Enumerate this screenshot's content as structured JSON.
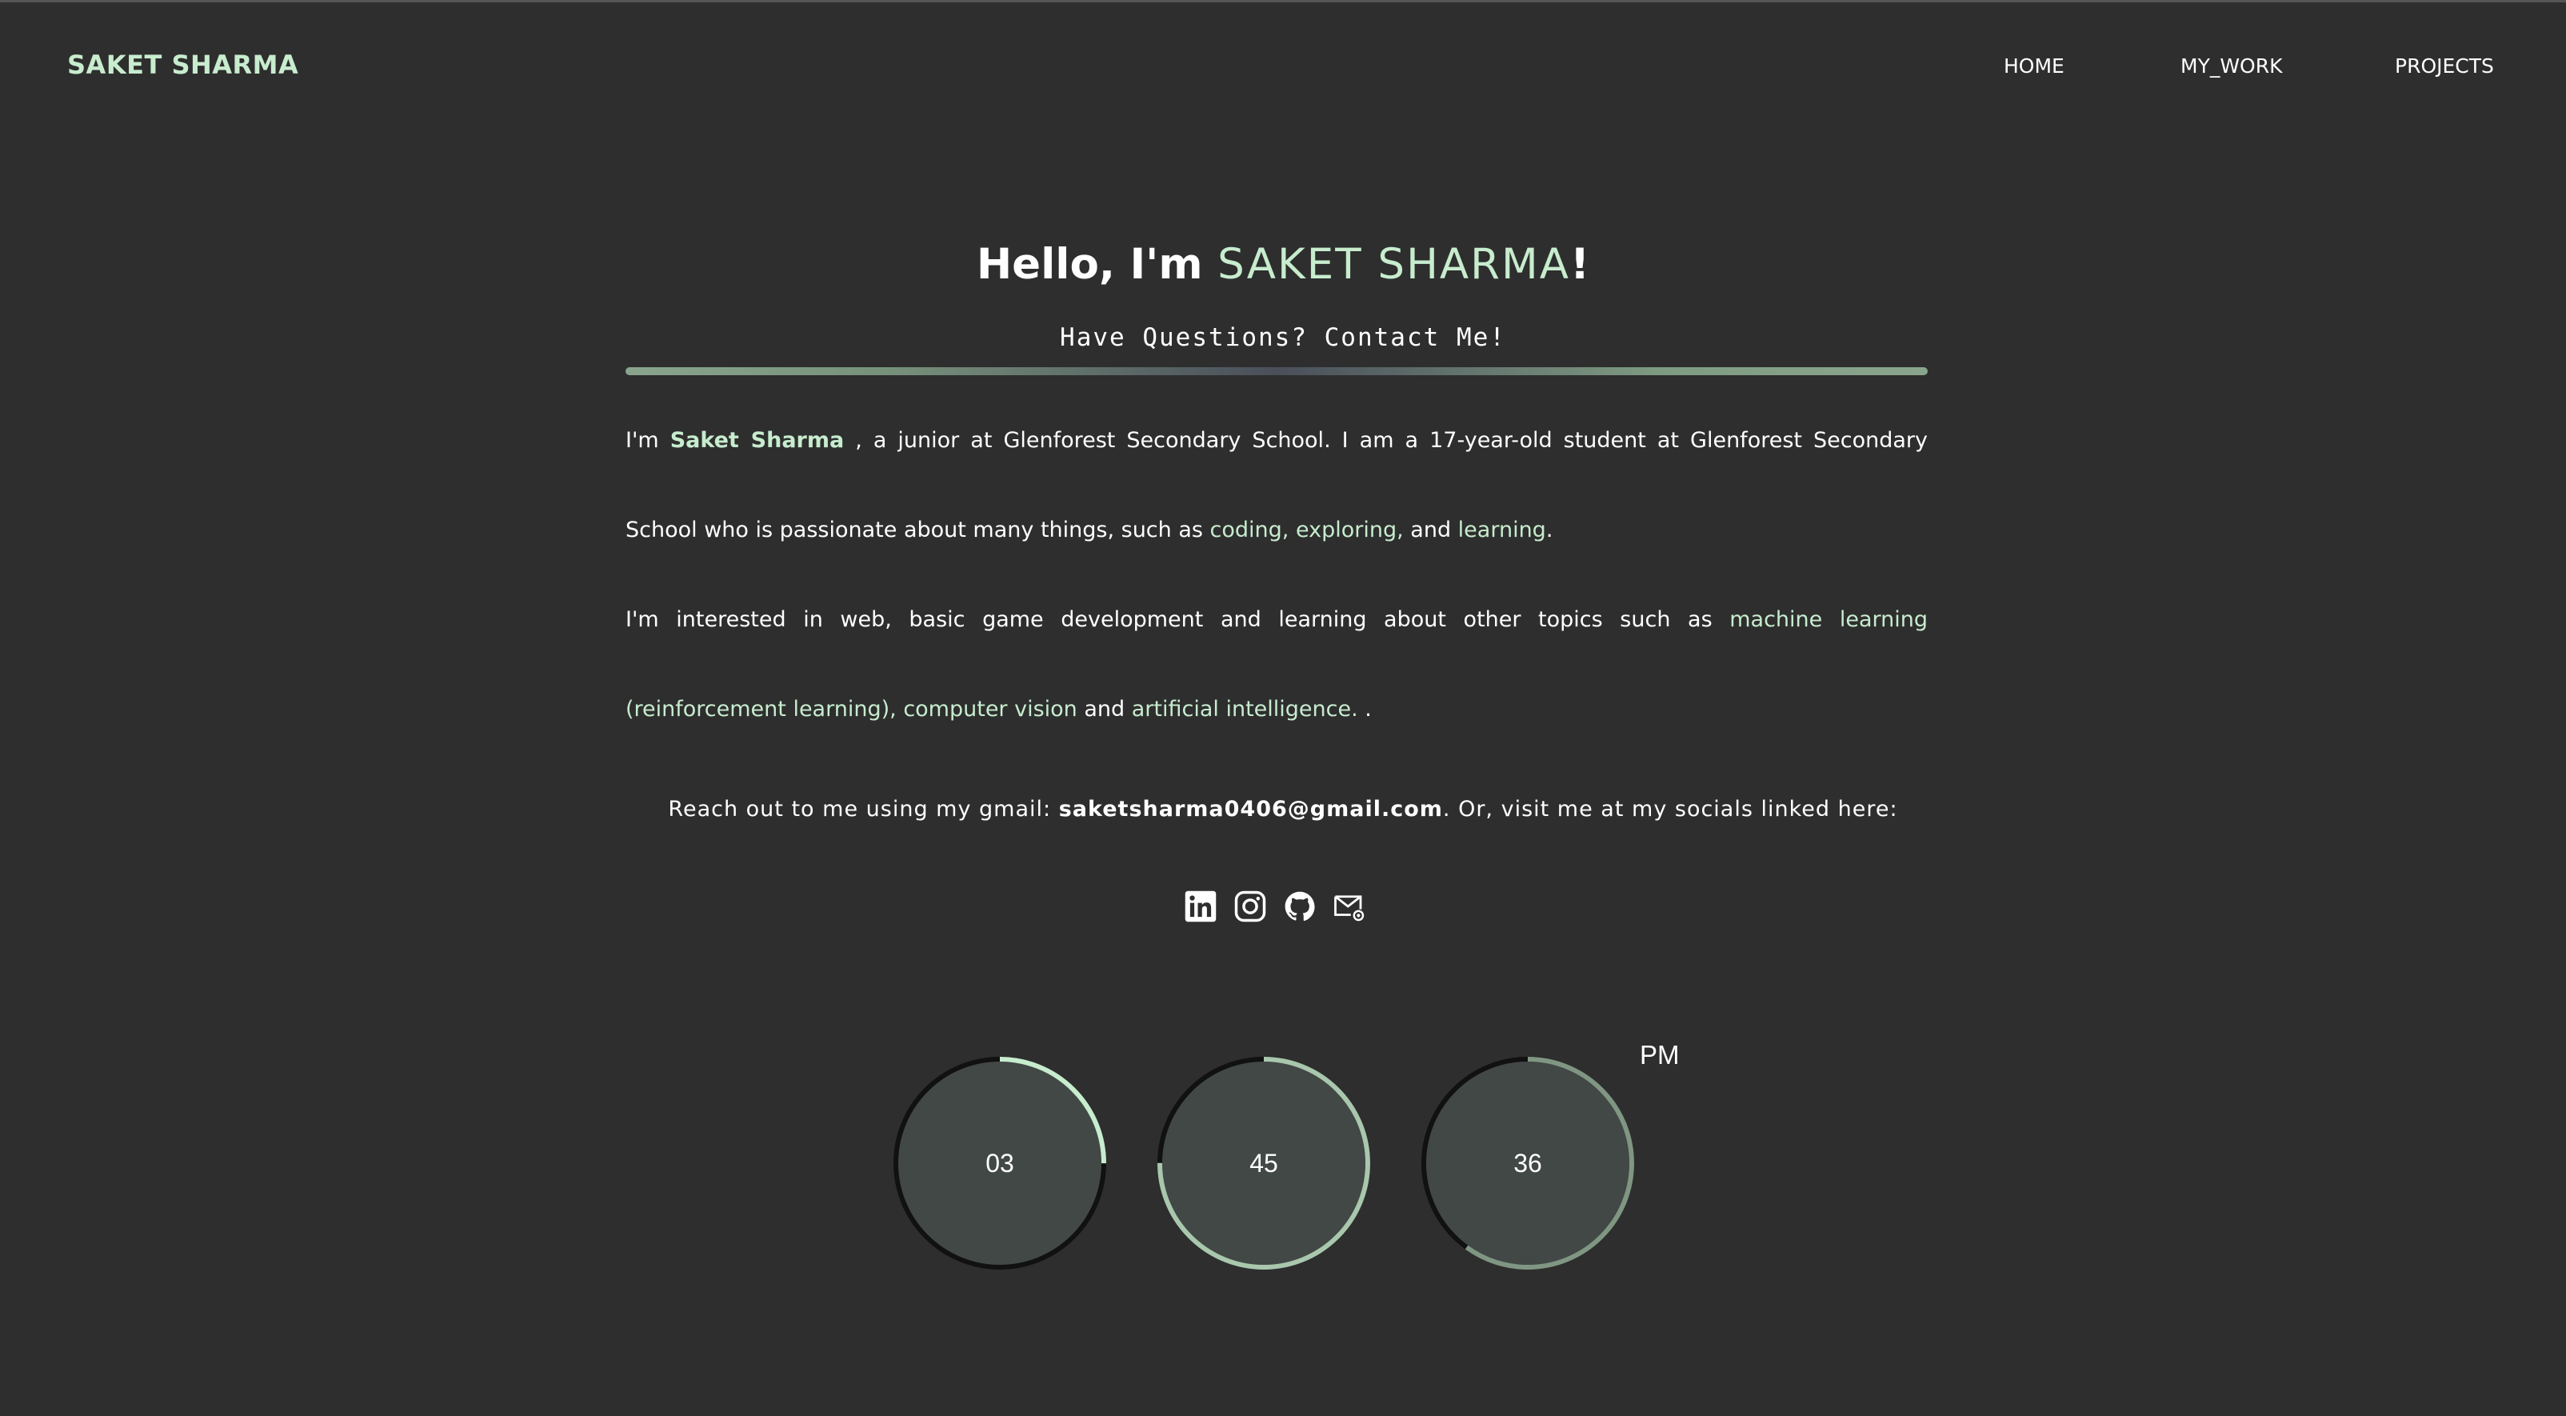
{
  "brand": "SAKET SHARMA",
  "nav": [
    {
      "label": "HOME"
    },
    {
      "label": "MY_WORK"
    },
    {
      "label": "PROJECTS"
    }
  ],
  "hero": {
    "prefix": "Hello, I'm ",
    "name": "SAKET SHARMA",
    "suffix": "!"
  },
  "subtitle": "Have Questions? Contact Me!",
  "about": {
    "p1_a": "I'm ",
    "p1_name": "Saket Sharma",
    "p1_b": " , a junior at Glenforest Secondary School. I am a 17-year-old student at Glenforest Secondary School who is passionate about many things, such as ",
    "p1_coding": "coding,",
    "p1_exploring": "exploring,",
    "p1_and": " and ",
    "p1_learning": "learning",
    "p1_end": ".",
    "p2_a": "I'm interested in web, basic game development and learning about other topics such as ",
    "p2_ml": "machine learning (reinforcement learning),",
    "p2_cv": "computer vision",
    "p2_and": " and ",
    "p2_ai": "artificial intelligence.",
    "p2_end": " ."
  },
  "contact": {
    "prefix": "Reach out to me using my gmail: ",
    "email": "saketsharma0406@gmail.com",
    "suffix": ". Or, visit me at my socials linked here:"
  },
  "socials": [
    {
      "icon": "linkedin-icon"
    },
    {
      "icon": "instagram-icon"
    },
    {
      "icon": "github-icon"
    },
    {
      "icon": "email-icon"
    }
  ],
  "clock": {
    "hours": "03",
    "minutes": "45",
    "seconds": "36",
    "ampm": "PM",
    "hours_fraction": 0.25,
    "minutes_fraction": 0.75,
    "seconds_fraction": 0.6,
    "colors": {
      "hours": "#c7ecce",
      "minutes": "#a9c7ad",
      "seconds": "#7f9683",
      "track": "#111111",
      "face": "#424846"
    }
  },
  "colors": {
    "background": "#2e2e2e",
    "accent": "#c7ecce"
  }
}
